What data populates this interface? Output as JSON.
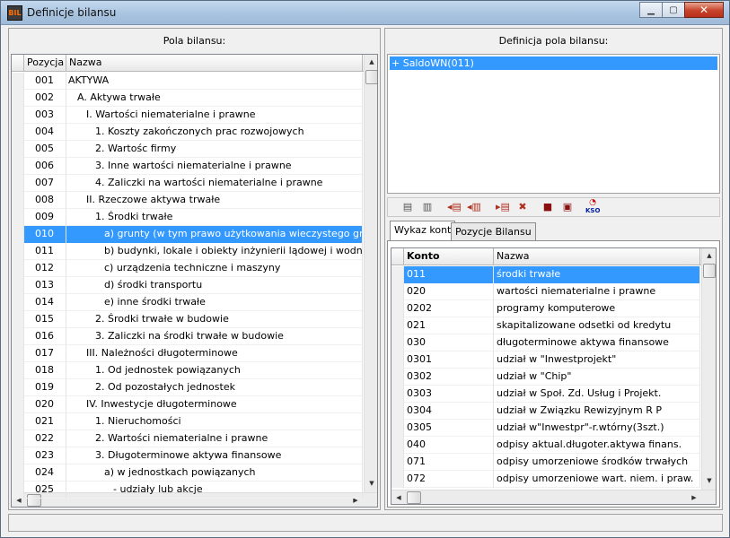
{
  "window": {
    "title": "Definicje bilansu",
    "app_icon_text": "BIL"
  },
  "left_panel": {
    "title": "Pola bilansu:",
    "columns": [
      "Pozycja",
      "Nazwa"
    ],
    "rows": [
      {
        "pos": "001",
        "name": "AKTYWA"
      },
      {
        "pos": "002",
        "name": "A. Aktywa trwałe"
      },
      {
        "pos": "003",
        "name": "I. Wartości niematerialne i prawne"
      },
      {
        "pos": "004",
        "name": "1. Koszty zakończonych prac rozwojowych"
      },
      {
        "pos": "005",
        "name": "2. Wartośc firmy"
      },
      {
        "pos": "006",
        "name": "3. Inne wartości niematerialne i prawne"
      },
      {
        "pos": "007",
        "name": "4. Zaliczki na wartości niematerialne i prawne"
      },
      {
        "pos": "008",
        "name": "II. Rzeczowe aktywa trwałe"
      },
      {
        "pos": "009",
        "name": "1. Środki trwałe"
      },
      {
        "pos": "010",
        "name": "a) grunty (w tym prawo użytkowania wieczystego gruntu)"
      },
      {
        "pos": "011",
        "name": "b) budynki, lokale i obiekty inżynierii lądowej i wodnej"
      },
      {
        "pos": "012",
        "name": "c) urządzenia techniczne i maszyny"
      },
      {
        "pos": "013",
        "name": "d) środki transportu"
      },
      {
        "pos": "014",
        "name": "e) inne środki trwałe"
      },
      {
        "pos": "015",
        "name": "2. Środki trwałe w budowie"
      },
      {
        "pos": "016",
        "name": "3. Zaliczki na środki trwałe w budowie"
      },
      {
        "pos": "017",
        "name": "III. Należności długoterminowe"
      },
      {
        "pos": "018",
        "name": "1. Od jednostek powiązanych"
      },
      {
        "pos": "019",
        "name": "2. Od pozostałych jednostek"
      },
      {
        "pos": "020",
        "name": "IV. Inwestycje długoterminowe"
      },
      {
        "pos": "021",
        "name": "1. Nieruchomości"
      },
      {
        "pos": "022",
        "name": "2. Wartości niematerialne i prawne"
      },
      {
        "pos": "023",
        "name": "3. Długoterminowe aktywa finansowe"
      },
      {
        "pos": "024",
        "name": "a) w jednostkach powiązanych"
      },
      {
        "pos": "025",
        "name": "- udziały lub akcje"
      }
    ],
    "selected_index": 9
  },
  "right_panel": {
    "title": "Definicja pola bilansu:",
    "definition_items": [
      "+ SaldoWN(011)"
    ],
    "toolbar_icons": [
      "copy-doc-icon",
      "paste-doc-icon",
      "insert-left-icon",
      "insert-left-alt-icon",
      "insert-right-icon",
      "delete-icon",
      "save-icon",
      "save-as-icon",
      "kso-icon"
    ],
    "toolbar_kso_label": "KSO",
    "tabs": [
      "Wykaz kont",
      "Pozycje Bilansu"
    ],
    "active_tab": 0,
    "accounts_columns": [
      "Konto",
      "Nazwa"
    ],
    "accounts": [
      {
        "konto": "011",
        "nazwa": "środki trwałe"
      },
      {
        "konto": "020",
        "nazwa": "wartości niematerialne i prawne"
      },
      {
        "konto": "0202",
        "nazwa": "programy komputerowe"
      },
      {
        "konto": "021",
        "nazwa": "skapitalizowane odsetki od kredytu"
      },
      {
        "konto": "030",
        "nazwa": "długoterminowe aktywa finansowe"
      },
      {
        "konto": "0301",
        "nazwa": "udział w \"Inwestprojekt\""
      },
      {
        "konto": "0302",
        "nazwa": "udział w \"Chip\""
      },
      {
        "konto": "0303",
        "nazwa": "udział w Społ. Zd. Usług i Projekt."
      },
      {
        "konto": "0304",
        "nazwa": "udział w Związku Rewizyjnym R P"
      },
      {
        "konto": "0305",
        "nazwa": "udział w\"Inwestpr\"-r.wtórny(3szt.)"
      },
      {
        "konto": "040",
        "nazwa": "odpisy aktual.długoter.aktywa finans."
      },
      {
        "konto": "071",
        "nazwa": "odpisy umorzeniowe środków trwałych"
      },
      {
        "konto": "072",
        "nazwa": "odpisy umorzeniowe wart. niem. i praw."
      }
    ],
    "selected_account": 0
  },
  "colors": {
    "selection": "#3399ff",
    "title_bar": "#a9c4e0",
    "close_button": "#c8432a"
  }
}
